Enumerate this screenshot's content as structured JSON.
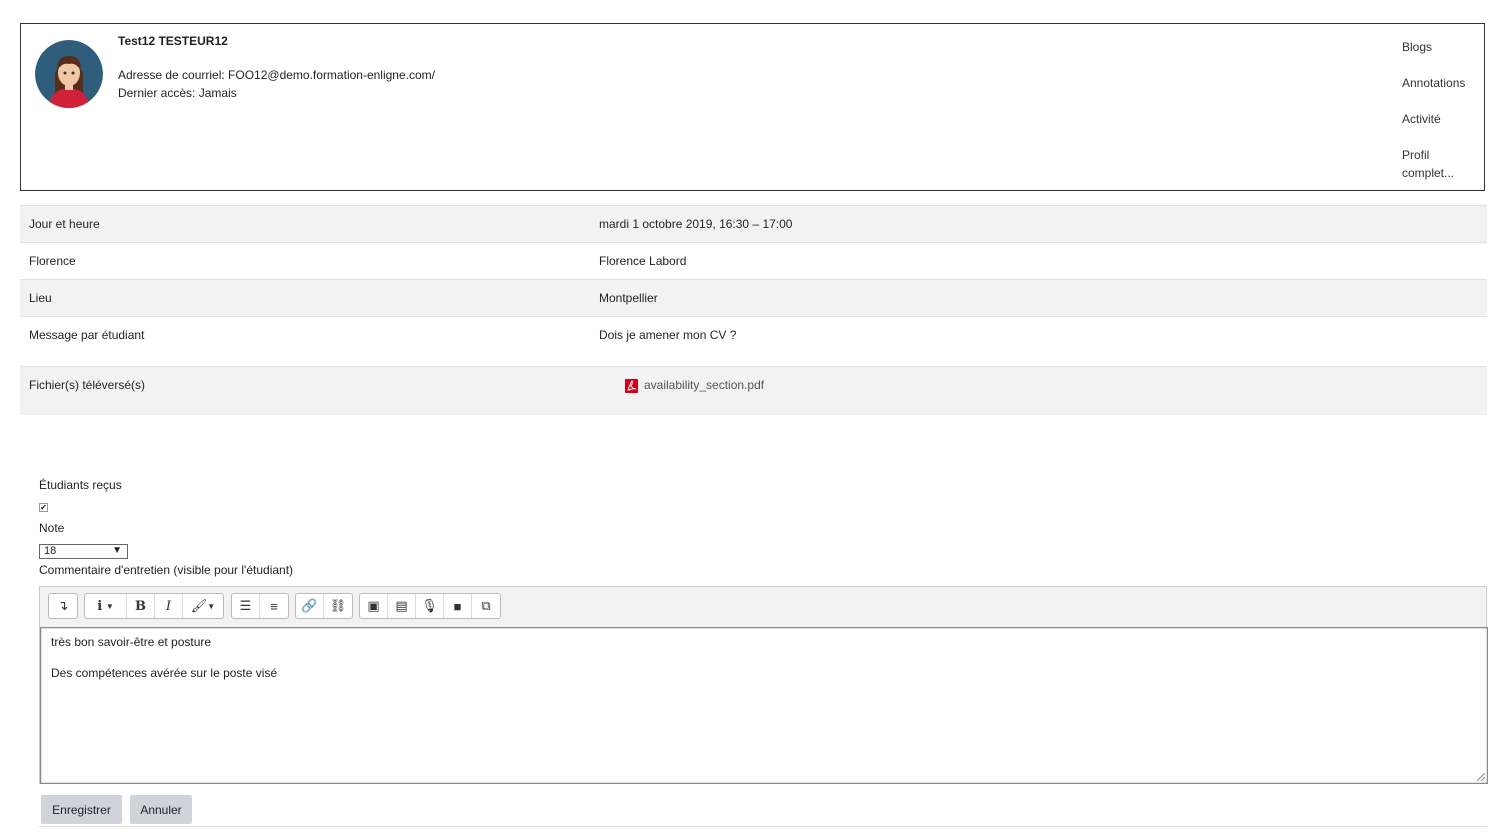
{
  "profile": {
    "name": "Test12 TESTEUR12",
    "email_line": "Adresse de courriel: FOO12@demo.formation-enligne.com/",
    "last_access_line": "Dernier accès: Jamais",
    "links": [
      "Blogs",
      "Annotations",
      "Activité",
      "Profil complet..."
    ]
  },
  "details": [
    {
      "label": "Jour et heure",
      "value": "mardi 1 octobre 2019, 16:30 – 17:00"
    },
    {
      "label": "Florence",
      "value": "Florence Labord"
    },
    {
      "label": "Lieu",
      "value": "Montpellier"
    },
    {
      "label": "Message par étudiant",
      "value": "Dois je amener mon CV ?"
    }
  ],
  "files": {
    "label": "Fichier(s) téléversé(s)",
    "filename": "availability_section.pdf",
    "icon": "pdf-icon"
  },
  "form": {
    "received_label": "Étudiants reçus",
    "received_checked": true,
    "grade_label": "Note",
    "grade_value": "18",
    "comment_label": "Commentaire d'entretien (visible pour l'étudiant)",
    "comment_lines": [
      "très bon savoir-être et posture",
      "Des compétences avérée sur le poste visé"
    ],
    "save_label": "Enregistrer",
    "cancel_label": "Annuler"
  },
  "toolbar_icons": [
    "expand-icon",
    "paragraph-style-icon",
    "bold-icon",
    "italic-icon",
    "text-color-icon",
    "bullet-list-icon",
    "numbered-list-icon",
    "link-icon",
    "unlink-icon",
    "image-icon",
    "media-icon",
    "record-audio-icon",
    "record-video-icon",
    "manage-files-icon"
  ],
  "colors": {
    "pdf": "#d0021b",
    "row_alt": "#f2f2f2",
    "button": "#ced4da"
  }
}
